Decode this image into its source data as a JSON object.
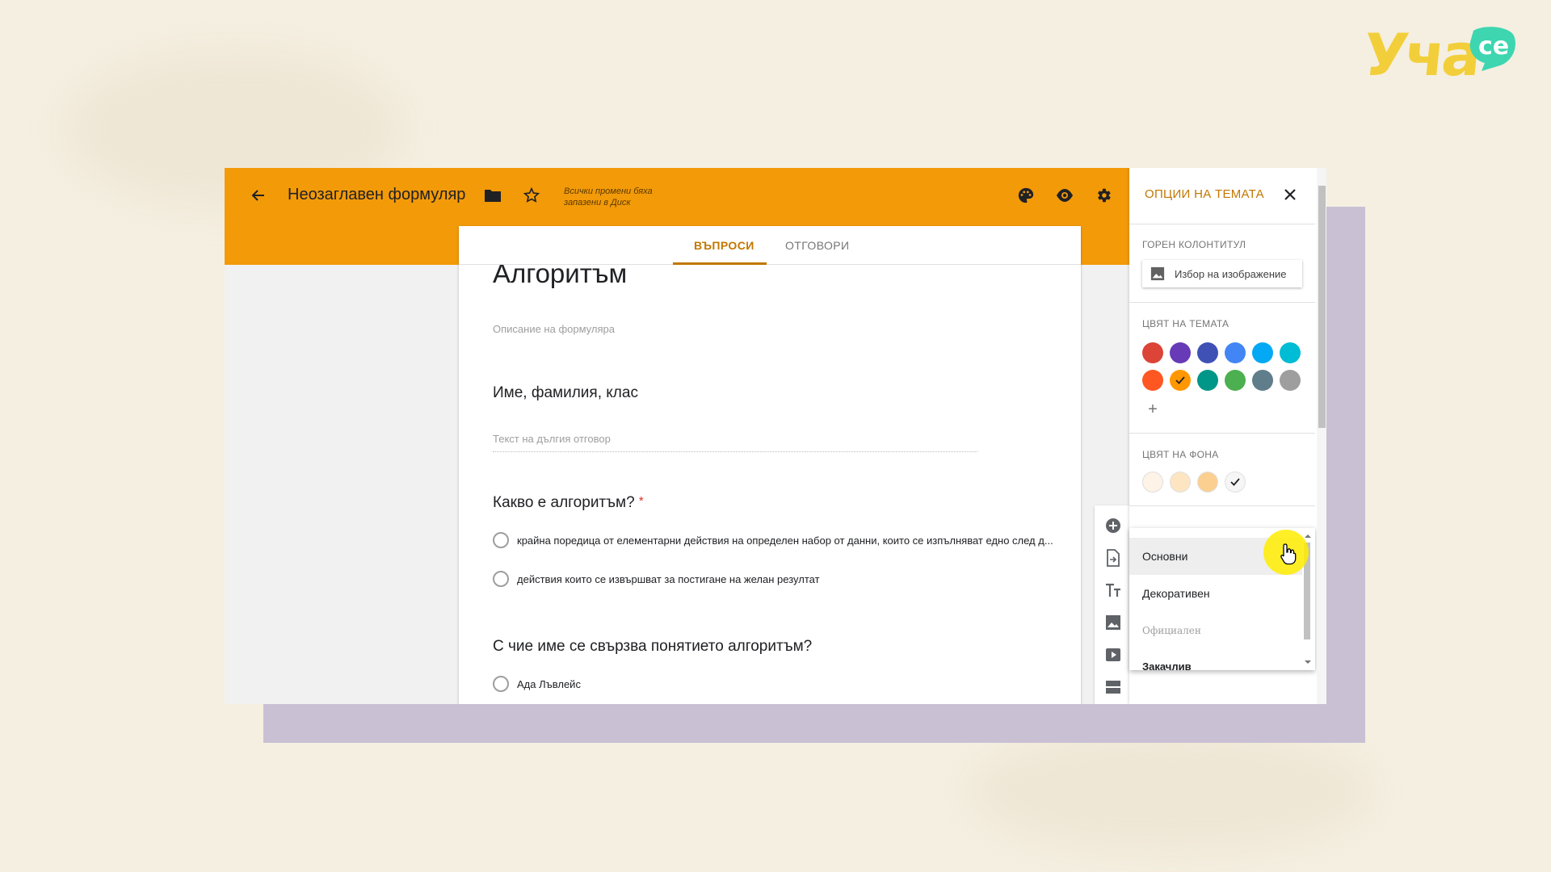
{
  "logo": {
    "main": "Уча",
    "bubble": "се"
  },
  "header": {
    "title": "Неозаглавен формуляр",
    "saved_status": "Всички промени бяха запазени в Диск"
  },
  "tabs": [
    {
      "label": "ВЪПРОСИ",
      "active": true
    },
    {
      "label": "ОТГОВОРИ",
      "active": false
    }
  ],
  "form": {
    "title": "Алгоритъм",
    "description_placeholder": "Описание на формуляра",
    "questions": [
      {
        "title": "Име, фамилия, клас",
        "type": "paragraph",
        "answer_placeholder": "Текст на дългия отговор",
        "required": false
      },
      {
        "title": "Какво е алгоритъм?",
        "required": true,
        "required_mark": "*",
        "type": "multiple_choice",
        "options": [
          "крайна поредица от елементарни действия на определен набор от данни, които се изпълняват едно след д...",
          "действия които се извършват за постигане на желан резултат"
        ]
      },
      {
        "title": "С чие име се свързва понятието алгоритъм?",
        "required": false,
        "type": "multiple_choice",
        "options": [
          "Ада Лъвлейс"
        ]
      }
    ]
  },
  "tools": [
    "add-question",
    "import-questions",
    "add-title",
    "add-image",
    "add-video",
    "add-section"
  ],
  "theme_panel": {
    "title": "ОПЦИИ НА ТЕМАТА",
    "header_label": "ГОРЕН КОЛОНТИТУЛ",
    "choose_image_label": "Избор на изображение",
    "theme_color_label": "ЦВЯТ НА ТЕМАТА",
    "theme_colors": [
      "#db4437",
      "#673ab7",
      "#3f51b5",
      "#4285f4",
      "#03a9f4",
      "#00bcd4",
      "#ff5722",
      "#ff9800",
      "#009688",
      "#4caf50",
      "#607d8b",
      "#9e9e9e"
    ],
    "selected_theme_color": "#ff9800",
    "add_color_label": "+",
    "bg_color_label": "ЦВЯТ НА ФОНА",
    "bg_colors": [
      "#fdf3e6",
      "#fde5c2",
      "#fbcf90",
      "#f6f6f6"
    ],
    "selected_bg_color": "#f6f6f6",
    "font_options": [
      "Основни",
      "Декоративен",
      "Официален",
      "Закачлив"
    ],
    "selected_font": "Основни"
  }
}
